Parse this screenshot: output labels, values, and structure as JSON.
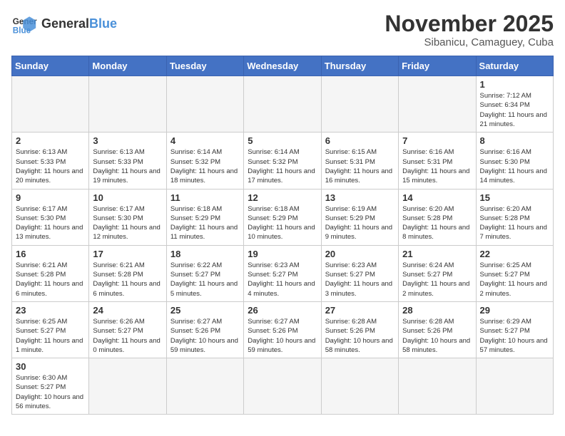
{
  "logo": {
    "text_general": "General",
    "text_blue": "Blue"
  },
  "title": "November 2025",
  "subtitle": "Sibanicu, Camaguey, Cuba",
  "days_of_week": [
    "Sunday",
    "Monday",
    "Tuesday",
    "Wednesday",
    "Thursday",
    "Friday",
    "Saturday"
  ],
  "weeks": [
    [
      {
        "day": "",
        "empty": true
      },
      {
        "day": "",
        "empty": true
      },
      {
        "day": "",
        "empty": true
      },
      {
        "day": "",
        "empty": true
      },
      {
        "day": "",
        "empty": true
      },
      {
        "day": "",
        "empty": true
      },
      {
        "day": "1",
        "info": "Sunrise: 7:12 AM\nSunset: 6:34 PM\nDaylight: 11 hours and 21 minutes."
      }
    ],
    [
      {
        "day": "2",
        "info": "Sunrise: 6:13 AM\nSunset: 5:33 PM\nDaylight: 11 hours and 20 minutes."
      },
      {
        "day": "3",
        "info": "Sunrise: 6:13 AM\nSunset: 5:33 PM\nDaylight: 11 hours and 19 minutes."
      },
      {
        "day": "4",
        "info": "Sunrise: 6:14 AM\nSunset: 5:32 PM\nDaylight: 11 hours and 18 minutes."
      },
      {
        "day": "5",
        "info": "Sunrise: 6:14 AM\nSunset: 5:32 PM\nDaylight: 11 hours and 17 minutes."
      },
      {
        "day": "6",
        "info": "Sunrise: 6:15 AM\nSunset: 5:31 PM\nDaylight: 11 hours and 16 minutes."
      },
      {
        "day": "7",
        "info": "Sunrise: 6:16 AM\nSunset: 5:31 PM\nDaylight: 11 hours and 15 minutes."
      },
      {
        "day": "8",
        "info": "Sunrise: 6:16 AM\nSunset: 5:30 PM\nDaylight: 11 hours and 14 minutes."
      }
    ],
    [
      {
        "day": "9",
        "info": "Sunrise: 6:17 AM\nSunset: 5:30 PM\nDaylight: 11 hours and 13 minutes."
      },
      {
        "day": "10",
        "info": "Sunrise: 6:17 AM\nSunset: 5:30 PM\nDaylight: 11 hours and 12 minutes."
      },
      {
        "day": "11",
        "info": "Sunrise: 6:18 AM\nSunset: 5:29 PM\nDaylight: 11 hours and 11 minutes."
      },
      {
        "day": "12",
        "info": "Sunrise: 6:18 AM\nSunset: 5:29 PM\nDaylight: 11 hours and 10 minutes."
      },
      {
        "day": "13",
        "info": "Sunrise: 6:19 AM\nSunset: 5:29 PM\nDaylight: 11 hours and 9 minutes."
      },
      {
        "day": "14",
        "info": "Sunrise: 6:20 AM\nSunset: 5:28 PM\nDaylight: 11 hours and 8 minutes."
      },
      {
        "day": "15",
        "info": "Sunrise: 6:20 AM\nSunset: 5:28 PM\nDaylight: 11 hours and 7 minutes."
      }
    ],
    [
      {
        "day": "16",
        "info": "Sunrise: 6:21 AM\nSunset: 5:28 PM\nDaylight: 11 hours and 6 minutes."
      },
      {
        "day": "17",
        "info": "Sunrise: 6:21 AM\nSunset: 5:28 PM\nDaylight: 11 hours and 6 minutes."
      },
      {
        "day": "18",
        "info": "Sunrise: 6:22 AM\nSunset: 5:27 PM\nDaylight: 11 hours and 5 minutes."
      },
      {
        "day": "19",
        "info": "Sunrise: 6:23 AM\nSunset: 5:27 PM\nDaylight: 11 hours and 4 minutes."
      },
      {
        "day": "20",
        "info": "Sunrise: 6:23 AM\nSunset: 5:27 PM\nDaylight: 11 hours and 3 minutes."
      },
      {
        "day": "21",
        "info": "Sunrise: 6:24 AM\nSunset: 5:27 PM\nDaylight: 11 hours and 2 minutes."
      },
      {
        "day": "22",
        "info": "Sunrise: 6:25 AM\nSunset: 5:27 PM\nDaylight: 11 hours and 2 minutes."
      }
    ],
    [
      {
        "day": "23",
        "info": "Sunrise: 6:25 AM\nSunset: 5:27 PM\nDaylight: 11 hours and 1 minute."
      },
      {
        "day": "24",
        "info": "Sunrise: 6:26 AM\nSunset: 5:27 PM\nDaylight: 11 hours and 0 minutes."
      },
      {
        "day": "25",
        "info": "Sunrise: 6:27 AM\nSunset: 5:26 PM\nDaylight: 10 hours and 59 minutes."
      },
      {
        "day": "26",
        "info": "Sunrise: 6:27 AM\nSunset: 5:26 PM\nDaylight: 10 hours and 59 minutes."
      },
      {
        "day": "27",
        "info": "Sunrise: 6:28 AM\nSunset: 5:26 PM\nDaylight: 10 hours and 58 minutes."
      },
      {
        "day": "28",
        "info": "Sunrise: 6:28 AM\nSunset: 5:26 PM\nDaylight: 10 hours and 58 minutes."
      },
      {
        "day": "29",
        "info": "Sunrise: 6:29 AM\nSunset: 5:27 PM\nDaylight: 10 hours and 57 minutes."
      }
    ],
    [
      {
        "day": "30",
        "info": "Sunrise: 6:30 AM\nSunset: 5:27 PM\nDaylight: 10 hours and 56 minutes."
      },
      {
        "day": "",
        "empty": true
      },
      {
        "day": "",
        "empty": true
      },
      {
        "day": "",
        "empty": true
      },
      {
        "day": "",
        "empty": true
      },
      {
        "day": "",
        "empty": true
      },
      {
        "day": "",
        "empty": true
      }
    ]
  ]
}
